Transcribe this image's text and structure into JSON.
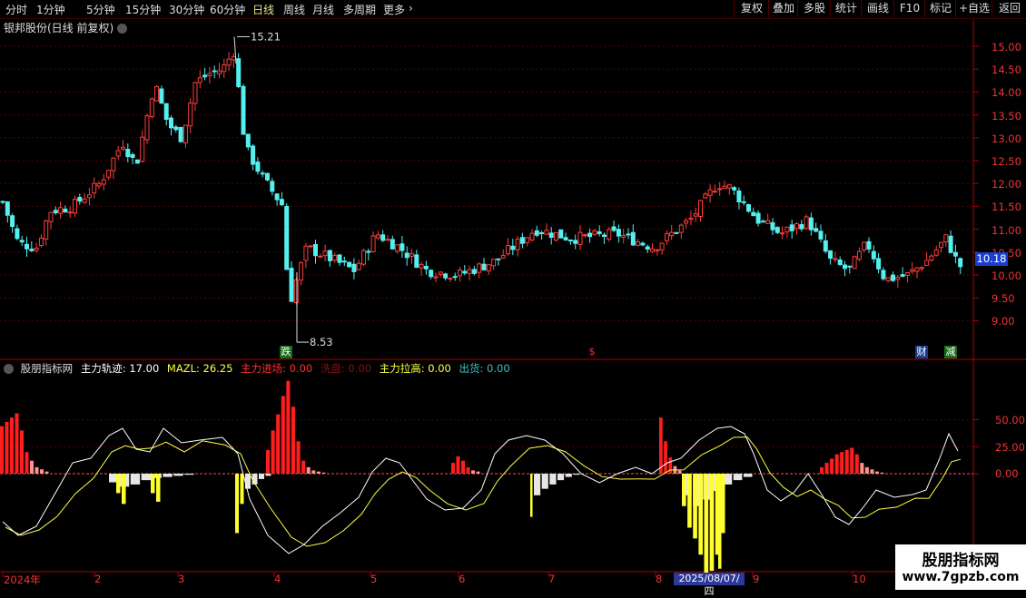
{
  "toolbar": {
    "periods": [
      "分时",
      "1分钟",
      "5分钟",
      "15分钟",
      "30分钟",
      "60分钟",
      "日线",
      "周线",
      "月线",
      "多周期",
      "更多"
    ],
    "more_arrow": "›",
    "right_buttons": [
      "复权",
      "叠加",
      "多股",
      "统计",
      "画线",
      "F10",
      "标记",
      "+自选",
      "返回"
    ]
  },
  "main_chart": {
    "title": "银邦股份(日线 前复权)",
    "y_ticks": [
      "15.00",
      "14.50",
      "14.00",
      "13.50",
      "13.00",
      "12.50",
      "12.00",
      "11.50",
      "11.00",
      "10.50",
      "10.00",
      "9.50",
      "9.00"
    ],
    "current_price": "10.18",
    "high_label": "15.21",
    "low_label": "8.53",
    "event_markers": [
      "跌",
      "$",
      "财",
      "减"
    ]
  },
  "indicator": {
    "name": "股朋指标网",
    "values": [
      {
        "label": "主力轨迹: 17.00",
        "color": "#ffffff"
      },
      {
        "label": "MAZL: 26.25",
        "color": "#ffff40"
      },
      {
        "label": "主力进场: 0.00",
        "color": "#ff3030"
      },
      {
        "label": "洗盘: 0.00",
        "color": "#8a1010"
      },
      {
        "label": "主力拉高: 0.00",
        "color": "#ffff40"
      },
      {
        "label": "出货: 0.00",
        "color": "#40c0c0"
      }
    ],
    "y_ticks": [
      "50.00",
      "25.00",
      "0.00"
    ]
  },
  "x_axis": {
    "labels": [
      "2024年",
      "2",
      "3",
      "4",
      "5",
      "6",
      "7",
      "8",
      "9",
      "10"
    ],
    "cursor_date": "2025/08/07/四"
  },
  "watermark": {
    "line1": "股朋指标网",
    "line2": "www.7gpzb.com"
  },
  "colors": {
    "up": "#ff3c3c",
    "down": "#54f0f0",
    "grid": "#5a0000",
    "axis": "#b00000"
  }
}
